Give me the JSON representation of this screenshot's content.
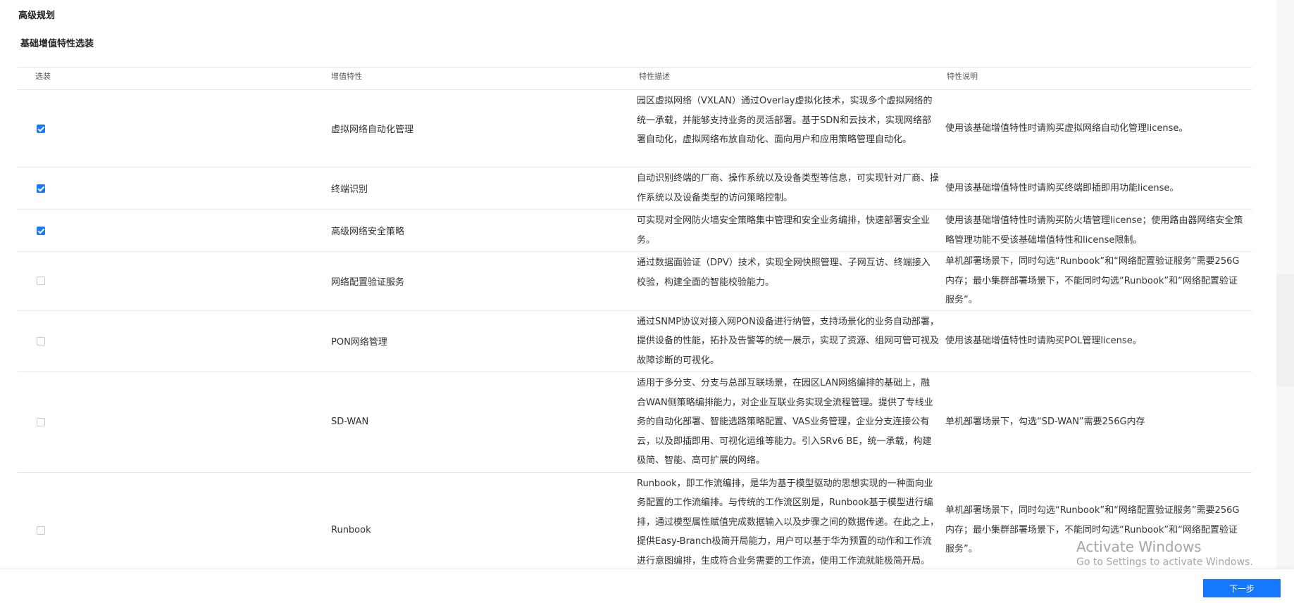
{
  "page": {
    "title": "高级规划",
    "section_title": "基础增值特性选装"
  },
  "colors": {
    "accent": "#1677ff",
    "border": "#e8e8e8",
    "text": "#333333"
  },
  "table": {
    "headers": [
      "选装",
      "增值特性",
      "特性描述",
      "特性说明"
    ],
    "rows": [
      {
        "checked": true,
        "feature": "虚拟网络自动化管理",
        "description": "园区虚拟网络（VXLAN）通过Overlay虚拟化技术，实现多个虚拟网络的统一承载，并能够支持业务的灵活部署。基于SDN和云技术，实现网络部署自动化，虚拟网络布放自动化、面向用户和应用策略管理自动化。",
        "note": "使用该基础增值特性时请购买虚拟网络自动化管理license。"
      },
      {
        "checked": true,
        "feature": "终端识别",
        "description": "自动识别终端的厂商、操作系统以及设备类型等信息，可实现针对厂商、操作系统以及设备类型的访问策略控制。",
        "note": "使用该基础增值特性时请购买终端即插即用功能license。"
      },
      {
        "checked": true,
        "feature": "高级网络安全策略",
        "description": "可实现对全网防火墙安全策略集中管理和安全业务编排，快速部署安全业务。",
        "note": "使用该基础增值特性时请购买防火墙管理license；使用路由器网络安全策略管理功能不受该基础增值特性和license限制。"
      },
      {
        "checked": false,
        "feature": "网络配置验证服务",
        "description": "通过数据面验证（DPV）技术，实现全网快照管理、子网互访、终端接入校验，构建全面的智能校验能力。",
        "note": "单机部署场景下，同时勾选“Runbook”和“网络配置验证服务”需要256G内存；最小集群部署场景下，不能同时勾选“Runbook”和“网络配置验证服务”。"
      },
      {
        "checked": false,
        "feature": "PON网络管理",
        "description": "通过SNMP协议对接入网PON设备进行纳管，支持场景化的业务自动部署，提供设备的性能，拓扑及告警等的统一展示，实现了资源、组网可管可视及故障诊断的可视化。",
        "note": "使用该基础增值特性时请购买POL管理license。"
      },
      {
        "checked": false,
        "feature": "SD-WAN",
        "description": "适用于多分支、分支与总部互联场景，在园区LAN网络编排的基础上，融合WAN侧策略编排能力，对企业互联业务实现全流程管理。提供了专线业务的自动化部署、智能选路策略配置、VAS业务管理，企业分支连接公有云，以及即插即用、可视化运维等能力。引入SRv6 BE，统一承载，构建极简、智能、高可扩展的网络。",
        "note": "单机部署场景下，勾选“SD-WAN”需要256G内存"
      },
      {
        "checked": false,
        "feature": "Runbook",
        "description": "Runbook，即工作流编排，是华为基于模型驱动的思想实现的一种面向业务配置的工作流编排。与传统的工作流区别是，Runbook基于模型进行编排，通过模型属性赋值完成数据输入以及步骤之间的数据传递。在此之上，提供Easy-Branch极简开局能力，用户可以基于华为预置的动作和工作流进行意图编排，生成符合业务需要的工作流，使用工作流就能极简开局。",
        "note": "单机部署场景下，同时勾选“Runbook”和“网络配置验证服务”需要256G内存；最小集群部署场景下，不能同时勾选“Runbook”和“网络配置验证服务”。"
      }
    ]
  },
  "footer": {
    "next_label": "下一步"
  },
  "watermark": {
    "line1": "Activate Windows",
    "line2": "Go to Settings to activate Windows."
  }
}
